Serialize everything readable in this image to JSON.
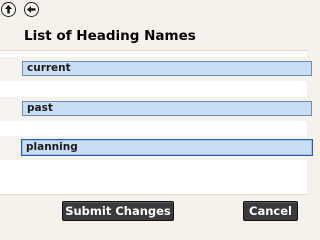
{
  "toolbar": {
    "up_icon": "arrow-up-icon",
    "back_icon": "arrow-left-icon"
  },
  "panel": {
    "title": "List of Heading Names"
  },
  "headings": [
    {
      "value": "current"
    },
    {
      "value": "past"
    },
    {
      "value": "planning"
    }
  ],
  "footer": {
    "submit_label": "Submit Changes",
    "cancel_label": "Cancel"
  },
  "colors": {
    "field_bg": "#c9def4",
    "field_border": "#6a8db6",
    "button_bg": "#3a3a3a",
    "panel_bg": "#f7f1ec"
  }
}
